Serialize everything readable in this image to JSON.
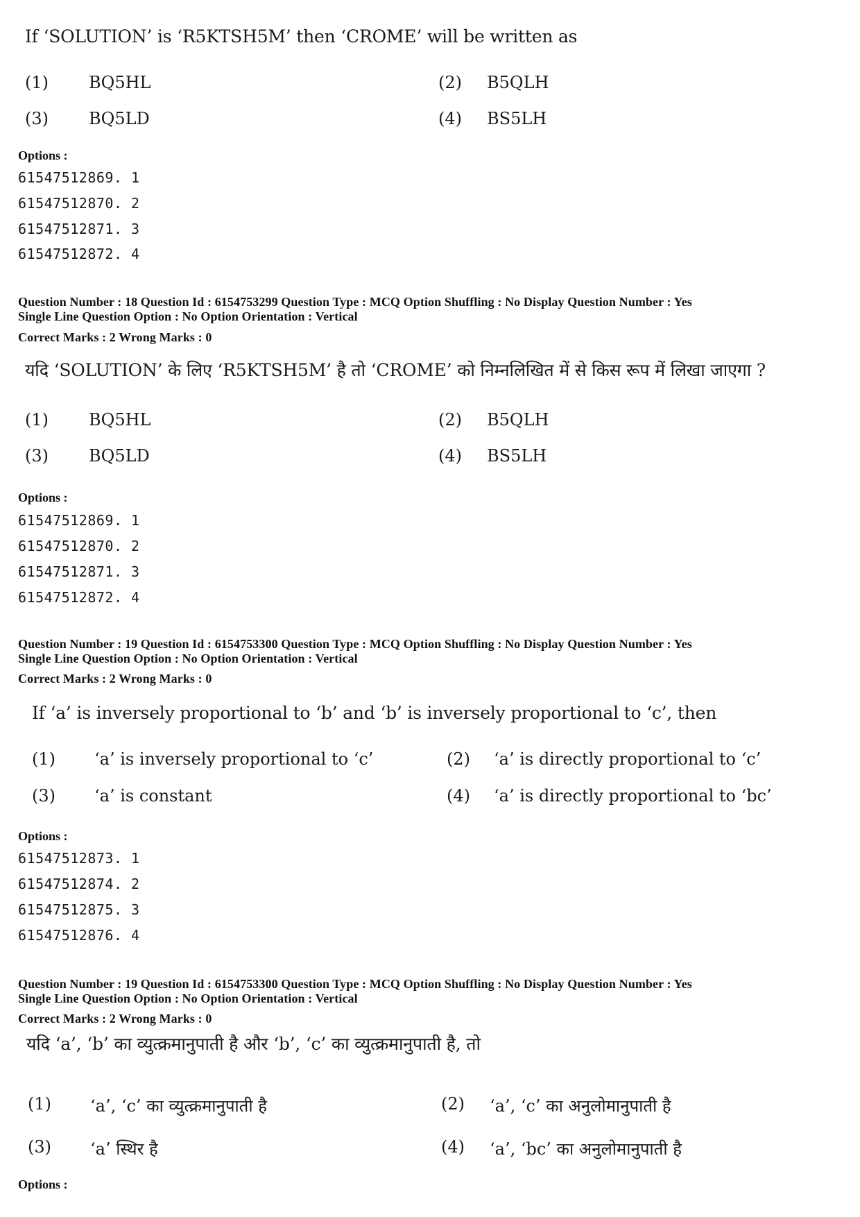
{
  "blocks": [
    {
      "question_text": "If ‘SOLUTION’ is ‘R5KTSH5M’ then ‘CROME’ will be written as",
      "choices": [
        {
          "num": "(1)",
          "text": "BQ5HL"
        },
        {
          "num": "(2)",
          "text": "B5QLH"
        },
        {
          "num": "(3)",
          "text": "BQ5LD"
        },
        {
          "num": "(4)",
          "text": "BS5LH"
        }
      ],
      "options_label": "Options :",
      "option_ids": [
        "61547512869. 1",
        "61547512870. 2",
        "61547512871. 3",
        "61547512872. 4"
      ]
    },
    {
      "meta_line1": "Question Number : 18  Question Id : 6154753299  Question Type : MCQ  Option Shuffling : No  Display Question Number : Yes",
      "meta_line2": "Single Line Question Option : No  Option Orientation : Vertical",
      "marks": "Correct Marks : 2  Wrong Marks : 0",
      "question_text": "यदि ‘SOLUTION’ के लिए ‘R5KTSH5M’ है तो ‘CROME’ को निम्नलिखित में से किस रूप में लिखा जाएगा ?",
      "choices": [
        {
          "num": "(1)",
          "text": "BQ5HL"
        },
        {
          "num": "(2)",
          "text": "B5QLH"
        },
        {
          "num": "(3)",
          "text": "BQ5LD"
        },
        {
          "num": "(4)",
          "text": "BS5LH"
        }
      ],
      "options_label": "Options :",
      "option_ids": [
        "61547512869. 1",
        "61547512870. 2",
        "61547512871. 3",
        "61547512872. 4"
      ]
    },
    {
      "meta_line1": "Question Number : 19  Question Id : 6154753300  Question Type : MCQ  Option Shuffling : No  Display Question Number : Yes",
      "meta_line2": "Single Line Question Option : No  Option Orientation : Vertical",
      "marks": "Correct Marks : 2  Wrong Marks : 0",
      "question_text": "If ‘a’ is inversely proportional to ‘b’ and ‘b’ is inversely proportional to ‘c’, then",
      "choices": [
        {
          "num": "(1)",
          "text": "‘a’ is inversely proportional to ‘c’"
        },
        {
          "num": "(2)",
          "text": "‘a’ is directly proportional to ‘c’"
        },
        {
          "num": "(3)",
          "text": "‘a’ is constant"
        },
        {
          "num": "(4)",
          "text": "‘a’ is directly proportional to ‘bc’"
        }
      ],
      "options_label": "Options :",
      "option_ids": [
        "61547512873. 1",
        "61547512874. 2",
        "61547512875. 3",
        "61547512876. 4"
      ]
    },
    {
      "meta_line1": "Question Number : 19  Question Id : 6154753300  Question Type : MCQ  Option Shuffling : No  Display Question Number : Yes",
      "meta_line2": "Single Line Question Option : No  Option Orientation : Vertical",
      "marks": "Correct Marks : 2  Wrong Marks : 0",
      "question_text": "यदि ‘a’, ‘b’ का व्युत्क्रमानुपाती है और ‘b’, ‘c’ का व्युत्क्रमानुपाती है, तो",
      "choices": [
        {
          "num": "(1)",
          "text": "‘a’, ‘c’ का व्युत्क्रमानुपाती है"
        },
        {
          "num": "(2)",
          "text": "‘a’, ‘c’ का अनुलोमानुपाती है"
        },
        {
          "num": "(3)",
          "text": "‘a’ स्थिर है"
        },
        {
          "num": "(4)",
          "text": "‘a’, ‘bc’ का अनुलोमानुपाती है"
        }
      ],
      "options_label": "Options :"
    }
  ]
}
